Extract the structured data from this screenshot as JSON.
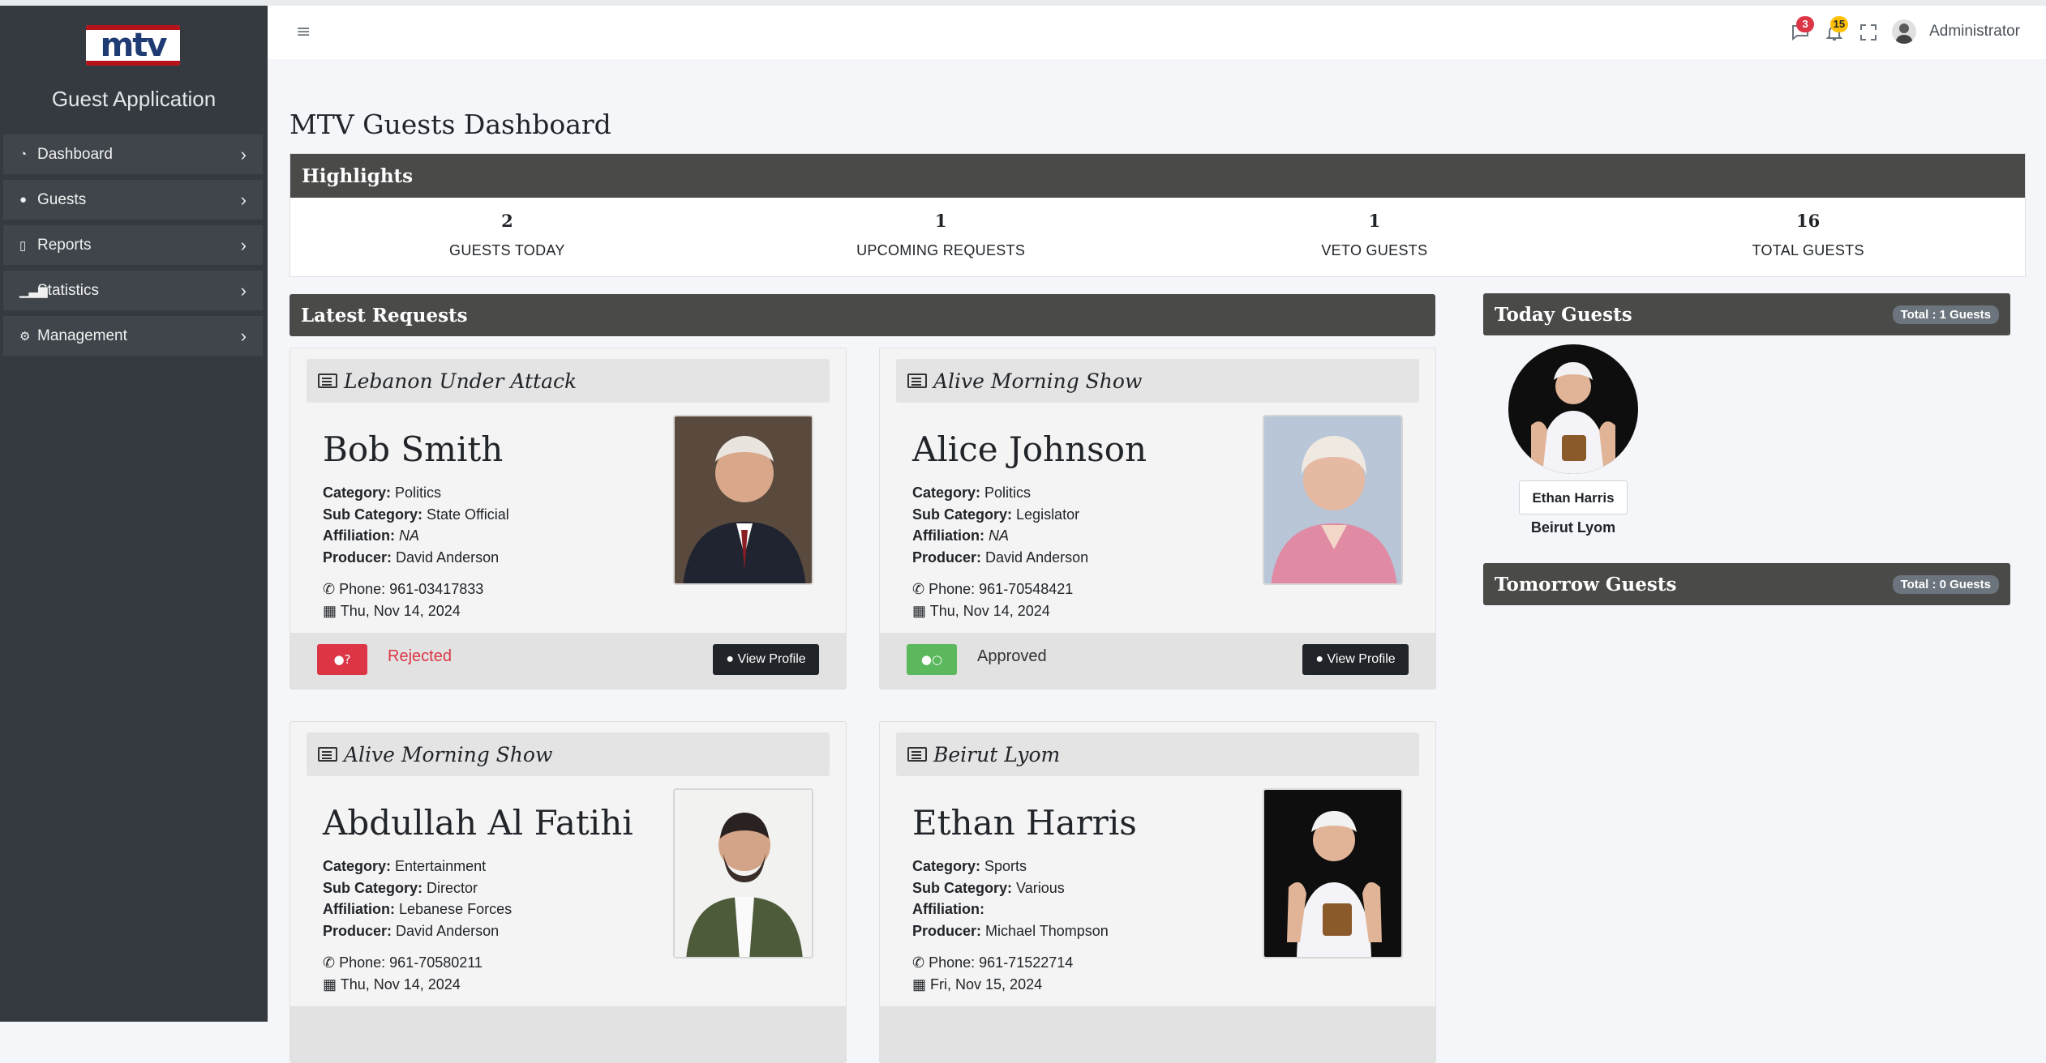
{
  "app": {
    "logo_text": "mtv",
    "title": "Guest Application"
  },
  "sidebar": {
    "items": [
      {
        "label": "Dashboard",
        "icon": "dashboard-icon"
      },
      {
        "label": "Guests",
        "icon": "user-icon"
      },
      {
        "label": "Reports",
        "icon": "file-icon"
      },
      {
        "label": "Statistics",
        "icon": "bar-chart-icon"
      },
      {
        "label": "Management",
        "icon": "gear-icon"
      }
    ]
  },
  "topbar": {
    "messages_count": "3",
    "notifications_count": "15",
    "user_name": "Administrator"
  },
  "page": {
    "title": "MTV Guests Dashboard"
  },
  "highlights": {
    "title": "Highlights",
    "items": [
      {
        "value": "2",
        "label": "GUESTS TODAY"
      },
      {
        "value": "1",
        "label": "UPCOMING REQUESTS"
      },
      {
        "value": "1",
        "label": "VETO GUESTS"
      },
      {
        "value": "16",
        "label": "TOTAL GUESTS"
      }
    ]
  },
  "latest_requests": {
    "title": "Latest Requests",
    "view_profile_label": "View Profile",
    "labels": {
      "category": "Category:",
      "sub_category": "Sub Category:",
      "affiliation": "Affiliation:",
      "producer": "Producer:"
    },
    "items": [
      {
        "show": "Lebanon Under Attack",
        "name": "Bob Smith",
        "category": "Politics",
        "sub_category": "State Official",
        "affiliation": "NA",
        "producer": "David Anderson",
        "phone": "Phone: 961-03417833",
        "date": "Thu, Nov 14, 2024",
        "status": "Rejected"
      },
      {
        "show": "Alive Morning Show",
        "name": "Alice Johnson",
        "category": "Politics",
        "sub_category": "Legislator",
        "affiliation": "NA",
        "producer": "David Anderson",
        "phone": "Phone: 961-70548421",
        "date": "Thu, Nov 14, 2024",
        "status": "Approved"
      },
      {
        "show": "Alive Morning Show",
        "name": "Abdullah Al Fatihi",
        "category": "Entertainment",
        "sub_category": "Director",
        "affiliation": "Lebanese Forces",
        "producer": "David Anderson",
        "phone": "Phone: 961-70580211",
        "date": "Thu, Nov 14, 2024",
        "status": ""
      },
      {
        "show": "Beirut Lyom",
        "name": "Ethan Harris",
        "category": "Sports",
        "sub_category": "Various",
        "affiliation": "",
        "producer": "Michael Thompson",
        "phone": "Phone: 961-71522714",
        "date": "Fri, Nov 15, 2024",
        "status": ""
      }
    ]
  },
  "today_guests": {
    "title": "Today Guests",
    "total": "Total : 1 Guests",
    "guests": [
      {
        "name": "Ethan Harris",
        "show": "Beirut Lyom"
      }
    ]
  },
  "tomorrow_guests": {
    "title": "Tomorrow Guests",
    "total": "Total : 0 Guests"
  }
}
